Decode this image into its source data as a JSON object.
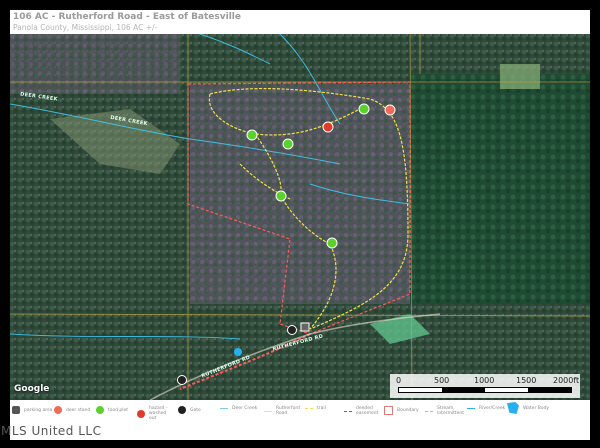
{
  "header": {
    "title": "106 AC - Rutherford Road - East of Batesville",
    "subtitle": "Panola County, Mississippi, 106 AC +/-"
  },
  "map": {
    "labels": {
      "creek": "DEER CREEK",
      "creek2": "DEER CREEK",
      "road": "RUTHERFORD RD",
      "road2": "RUTHERFORD RD"
    },
    "attribution": "Google",
    "scale": {
      "ticks": [
        "0",
        "500",
        "1000",
        "1500",
        "2000ft"
      ]
    },
    "colors": {
      "boundary": "#ff5a5a",
      "trail": "#f2e14a",
      "creek": "#3ec8f0",
      "food_plot": "#5ad12c",
      "hazard": "#e03a2a",
      "deer_stand": "#f06a5a"
    }
  },
  "legend": {
    "items": [
      {
        "label": "parking area",
        "icon": "parking-icon"
      },
      {
        "label": "deer stand",
        "icon": "deer-stand-icon"
      },
      {
        "label": "food plot",
        "icon": "food-plot-icon"
      },
      {
        "label": "hazard - washed out",
        "icon": "hazard-icon"
      },
      {
        "label": "Gate",
        "icon": "gate-icon"
      },
      {
        "label": "Deer Creek",
        "icon": "creek-line-icon"
      },
      {
        "label": "Rutherford Road",
        "icon": "road-line-icon"
      },
      {
        "label": "trail",
        "icon": "trail-line-icon"
      },
      {
        "label": "deeded easement",
        "icon": "easement-line-icon"
      },
      {
        "label": "Boundary",
        "icon": "boundary-icon"
      },
      {
        "label": "Stream, Intermittent",
        "icon": "stream-line-icon"
      },
      {
        "label": "River/Creek",
        "icon": "river-line-icon"
      },
      {
        "label": "Water Body",
        "icon": "water-body-icon"
      }
    ]
  },
  "watermark": "MLS United LLC"
}
